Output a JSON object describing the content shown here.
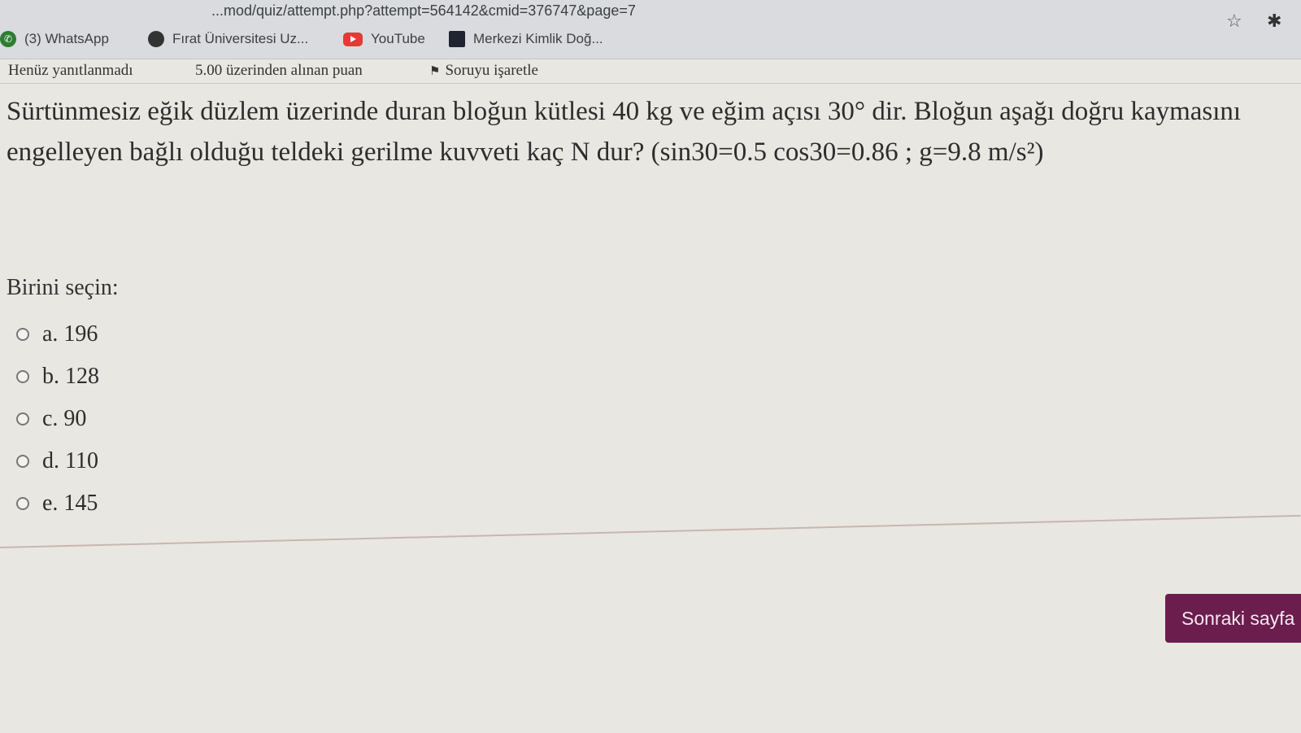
{
  "browser": {
    "url": "...mod/quiz/attempt.php?attempt=564142&cmid=376747&page=7",
    "bookmarks": [
      {
        "label": "(3) WhatsApp",
        "icon": "whatsapp-icon"
      },
      {
        "label": "Fırat Üniversitesi Uz...",
        "icon": "university-icon"
      },
      {
        "label": "YouTube",
        "icon": "youtube-icon"
      },
      {
        "label": "Merkezi Kimlik Doğ...",
        "icon": "identity-icon"
      }
    ]
  },
  "quiz": {
    "status": "Henüz yanıtlanmadı",
    "points": "5.00 üzerinden alınan puan",
    "flag_label": "Soruyu işaretle",
    "question": "Sürtünmesiz eğik düzlem üzerinde duran bloğun kütlesi 40 kg ve eğim açısı 30° dir. Bloğun aşağı doğru kaymasını engelleyen bağlı olduğu teldeki gerilme kuvveti kaç N dur? (sin30=0.5 cos30=0.86 ; g=9.8 m/s²)",
    "prompt": "Birini seçin:",
    "options": [
      "a. 196",
      "b. 128",
      "c. 90",
      "d. 110",
      "e. 145"
    ],
    "next_label": "Sonraki sayfa"
  },
  "colors": {
    "accent": "#6b1d4e",
    "page_bg": "#e9e7e2"
  }
}
